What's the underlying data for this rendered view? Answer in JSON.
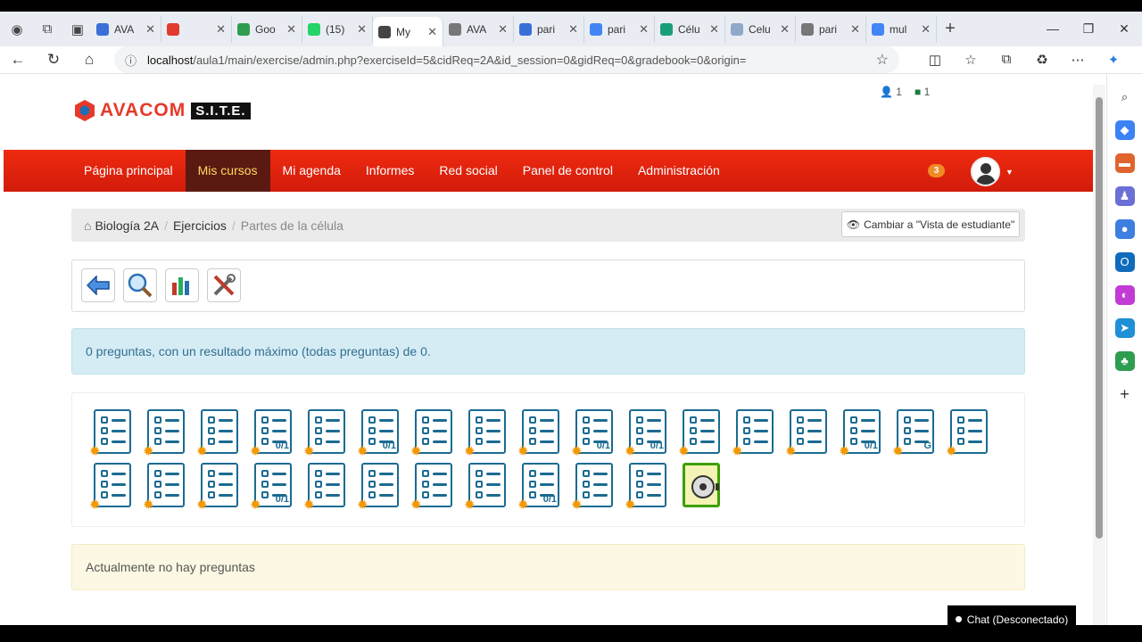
{
  "browser": {
    "tabs": [
      {
        "label": "AVA",
        "color": "#3a6fd8"
      },
      {
        "label": "",
        "color": "#e23b2e"
      },
      {
        "label": "Goo",
        "color": "#2e9d4f"
      },
      {
        "label": "(15)",
        "color": "#25d366"
      },
      {
        "label": "My",
        "color": "#444444",
        "active": true
      },
      {
        "label": "AVA",
        "color": "#777777"
      },
      {
        "label": "pari",
        "color": "#3a6fd8"
      },
      {
        "label": "pari",
        "color": "#4285f4"
      },
      {
        "label": "Célu",
        "color": "#1a9e7a"
      },
      {
        "label": "Celu",
        "color": "#8fa9c8"
      },
      {
        "label": "pari",
        "color": "#777777"
      },
      {
        "label": "mul",
        "color": "#4285f4"
      }
    ],
    "url_host": "localhost",
    "url_path": "/aula1/main/exercise/admin.php?exerciseId=5&cidReq=2A&id_session=0&gidReq=0&gradebook=0&origin="
  },
  "header": {
    "logo_text": "AVACOM",
    "logo_badge": "S.I.T.E.",
    "users_online": "1",
    "messages": "1"
  },
  "nav": {
    "items": [
      "Página principal",
      "Mis cursos",
      "Mi agenda",
      "Informes",
      "Red social",
      "Panel de control",
      "Administración"
    ],
    "active_index": 1,
    "notifications": "3"
  },
  "breadcrumb": {
    "items": [
      "Biología 2A",
      "Ejercicios",
      "Partes de la célula"
    ],
    "student_view_button": "Cambiar a \"Vista de estudiante\""
  },
  "info_message": "0 preguntas, con un resultado máximo (todas preguntas) de 0.",
  "question_types_count": 29,
  "question_type_scores": [
    "",
    "",
    "",
    "0/1",
    "",
    "0/1",
    "",
    "",
    "",
    "0/1",
    "0/1",
    "",
    "",
    "",
    "0/1",
    "G",
    "",
    "",
    "",
    "",
    "0/1",
    "",
    "",
    "",
    "",
    "0/1",
    "",
    "",
    ""
  ],
  "empty_message": "Actualmente no hay preguntas",
  "chat_label": "Chat (Desconectado)"
}
